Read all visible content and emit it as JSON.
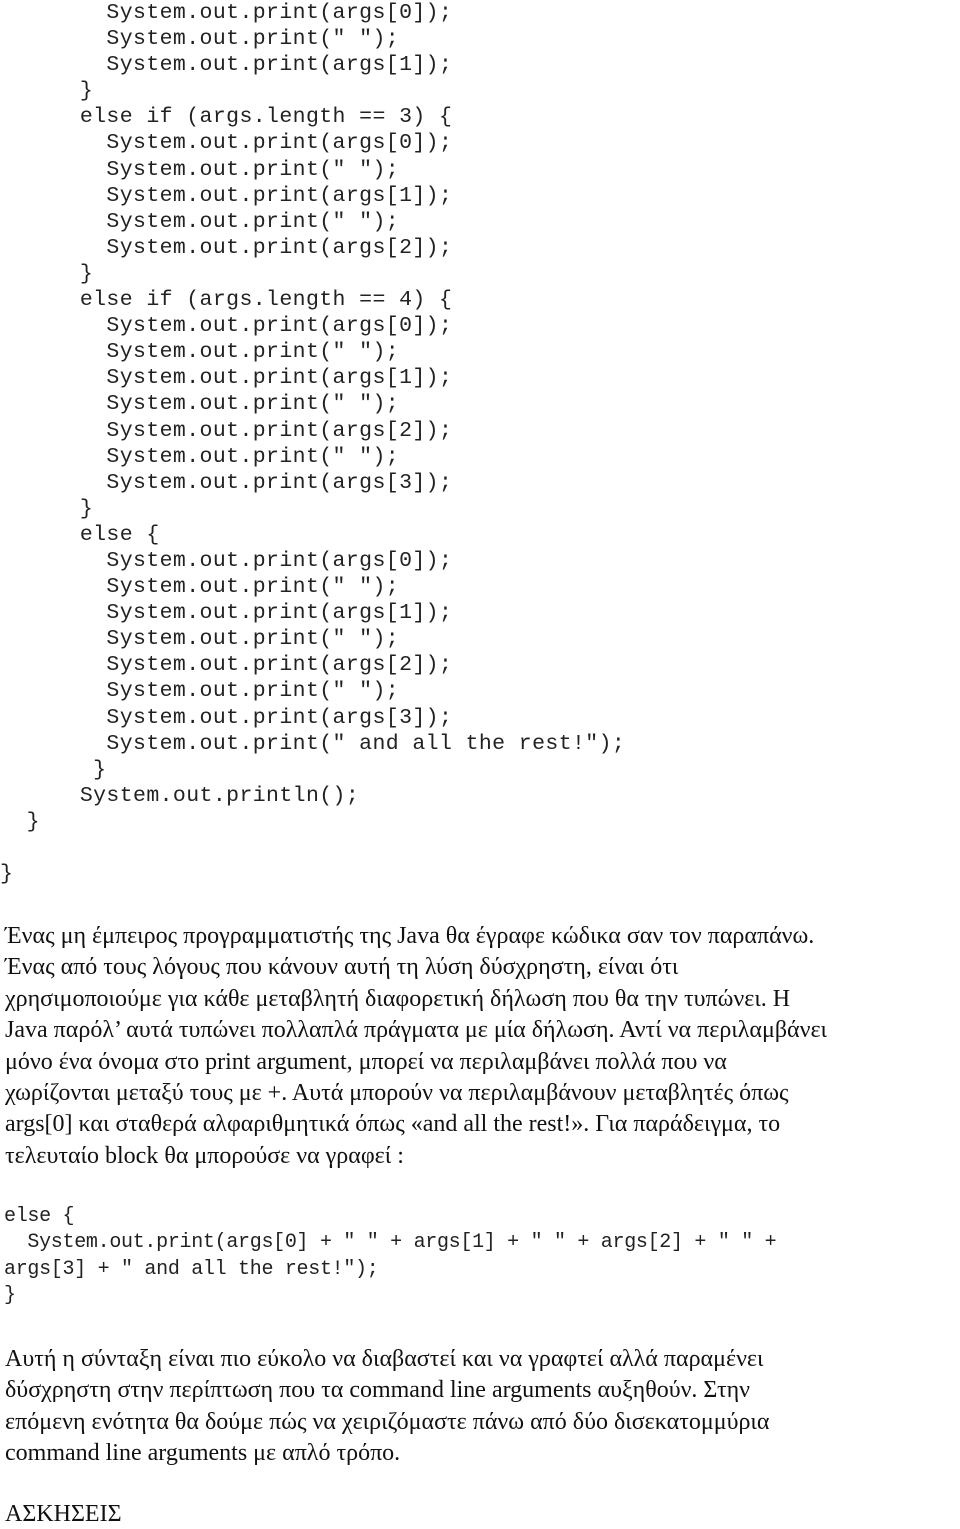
{
  "code_listing_1": {
    "lines": [
      "        System.out.print(args[0]);",
      "        System.out.print(\" \");",
      "        System.out.print(args[1]);",
      "      }",
      "      else if (args.length == 3) {",
      "        System.out.print(args[0]);",
      "        System.out.print(\" \");",
      "        System.out.print(args[1]);",
      "        System.out.print(\" \");",
      "        System.out.print(args[2]);",
      "      }",
      "      else if (args.length == 4) {",
      "        System.out.print(args[0]);",
      "        System.out.print(\" \");",
      "        System.out.print(args[1]);",
      "        System.out.print(\" \");",
      "        System.out.print(args[2]);",
      "        System.out.print(\" \");",
      "        System.out.print(args[3]);",
      "      }",
      "      else {",
      "        System.out.print(args[0]);",
      "        System.out.print(\" \");",
      "        System.out.print(args[1]);",
      "        System.out.print(\" \");",
      "        System.out.print(args[2]);",
      "        System.out.print(\" \");",
      "        System.out.print(args[3]);",
      "        System.out.print(\" and all the rest!\");",
      "       }",
      "      System.out.println();",
      "  }",
      "",
      "}"
    ]
  },
  "paragraph_1": "Ένας μη έμπειρος προγραμματιστής της Java θα έγραφε κώδικα σαν τον παραπάνω. Ένας από τους λόγους που κάνουν αυτή τη λύση δύσχρηστη, είναι ότι χρησιμοποιούμε για κάθε μεταβλητή διαφορετική δήλωση που θα την τυπώνει. Η Java παρόλ’ αυτά τυπώνει πολλαπλά πράγματα με μία δήλωση. Αντί να περιλαμβάνει μόνο ένα όνομα στο print argument, μπορεί να περιλαμβάνει πολλά που να χωρίζονται μεταξύ τους με +. Αυτά μπορούν να περιλαμβάνουν μεταβλητές όπως args[0] και σταθερά αλφαριθμητικά όπως «and all the rest!». Για παράδειγμα, το τελευταίο block θα μπορούσε να γραφεί :",
  "paragraph_1_lines": [
    "Ένας μη έμπειρος προγραμματιστής της Java θα έγραφε κώδικα σαν τον παραπάνω.",
    "Ένας από τους λόγους που κάνουν αυτή τη λύση δύσχρηστη, είναι ότι",
    "χρησιμοποιούμε για κάθε μεταβλητή διαφορετική δήλωση που θα την τυπώνει. Η",
    "Java παρόλ’ αυτά τυπώνει πολλαπλά πράγματα με μία δήλωση. Αντί να περιλαμβάνει",
    "μόνο ένα όνομα στο print argument, μπορεί να περιλαμβάνει πολλά που να",
    "χωρίζονται μεταξύ τους με +. Αυτά μπορούν να περιλαμβάνουν μεταβλητές όπως",
    "args[0] και σταθερά αλφαριθμητικά όπως «and all the rest!». Για παράδειγμα, το",
    "τελευταίο block θα μπορούσε να γραφεί :"
  ],
  "code_listing_2": {
    "lines": [
      "else {",
      "  System.out.print(args[0] + \" \" + args[1] + \" \" + args[2] + \" \" +",
      "args[3] + \" and all the rest!\");",
      "}"
    ]
  },
  "paragraph_2_lines": [
    "Αυτή η σύνταξη είναι πιο εύκολο να διαβαστεί και να γραφτεί αλλά παραμένει",
    "δύσχρηστη στην περίπτωση που τα command line arguments αυξηθούν. Στην",
    "επόμενη ενότητα θα δούμε πώς να χειριζόμαστε πάνω από δύο δισεκατομμύρια",
    "command line arguments με απλό τρόπο."
  ],
  "section_heading": "ΑΣΚΗΣΕΙΣ"
}
